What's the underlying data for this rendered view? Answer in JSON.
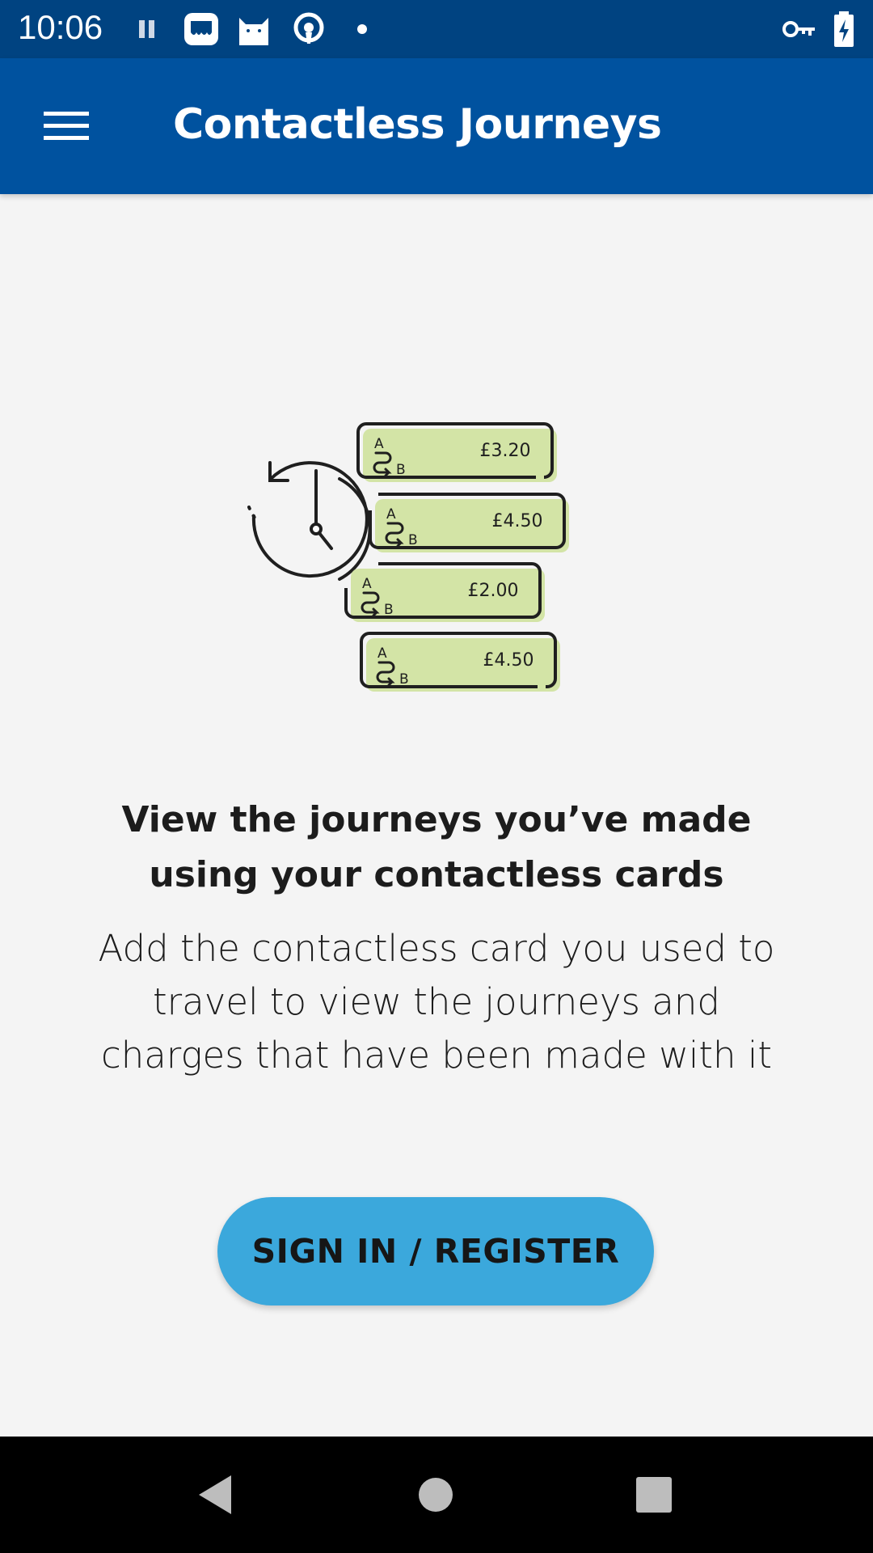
{
  "status_bar": {
    "time": "10:06",
    "icons": [
      "pause-icon",
      "app-notification-icon",
      "cat-app-icon",
      "podcast-icon",
      "dot-icon",
      "vpn-key-icon",
      "battery-charging-icon"
    ]
  },
  "app_bar": {
    "title": "Contactless Journeys",
    "menu_icon": "hamburger-menu-icon",
    "background": "#00529f"
  },
  "illustration": {
    "cards": [
      {
        "route": "A→B",
        "fare": "£3.20"
      },
      {
        "route": "A→B",
        "fare": "£4.50"
      },
      {
        "route": "A→B",
        "fare": "£2.00"
      },
      {
        "route": "A→B",
        "fare": "£4.50"
      }
    ],
    "card_color": "#d3e4a6"
  },
  "main": {
    "heading": "View the journeys you’ve made using your contactless cards",
    "body": "Add the contactless card you used to travel to view the journeys and charges that have been made with it",
    "cta_label": "SIGN IN / REGISTER",
    "cta_color": "#3ba8dc"
  },
  "nav_bar": {
    "buttons": [
      "back-icon",
      "home-icon",
      "recents-icon"
    ]
  }
}
